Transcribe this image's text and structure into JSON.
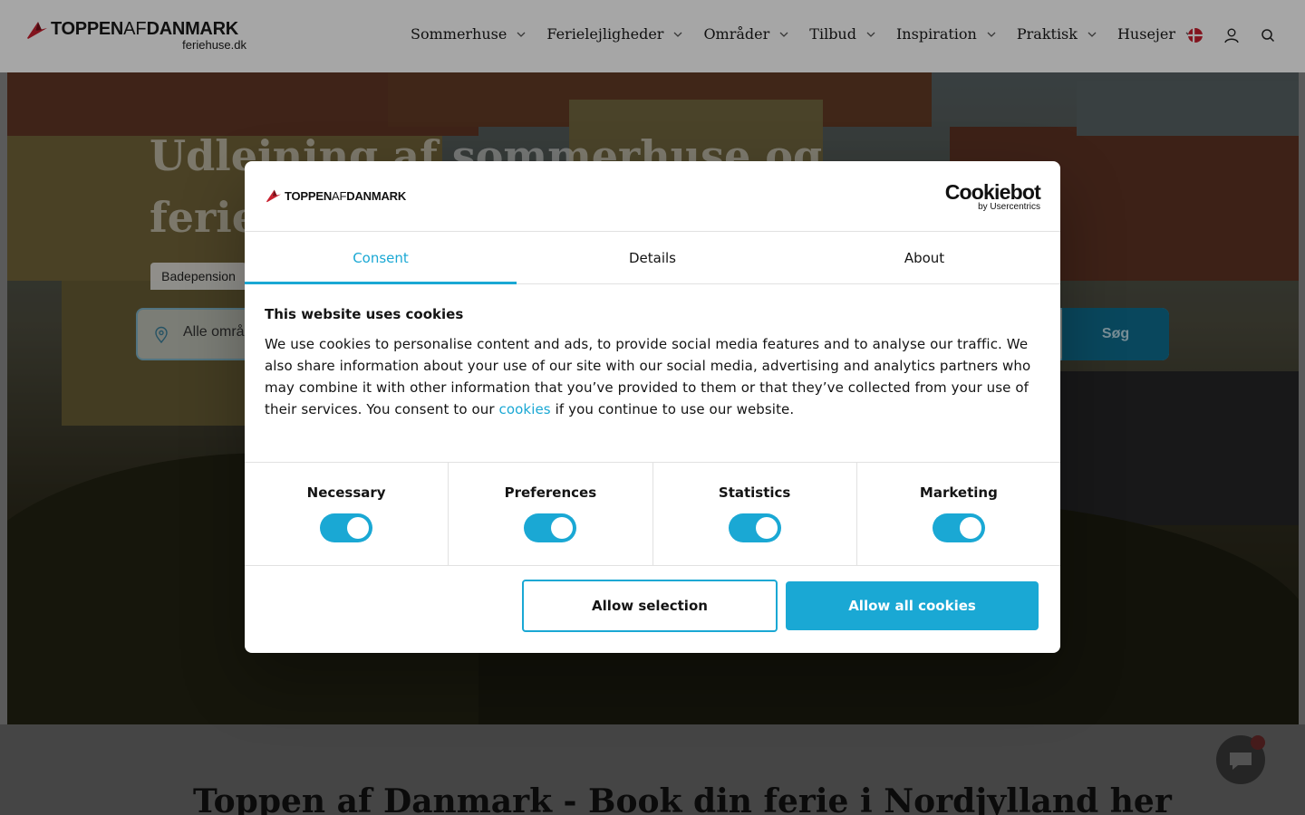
{
  "header": {
    "logo_text_bold_1": "TOPPEN",
    "logo_text_thin": "AF",
    "logo_text_bold_2": "DANMARK",
    "logo_sub": "feriehuse.dk",
    "nav": [
      {
        "label": "Sommerhuse",
        "icon": "chevron-down-icon"
      },
      {
        "label": "Ferielejligheder",
        "icon": "chevron-down-icon"
      },
      {
        "label": "Områder",
        "icon": "chevron-down-icon"
      },
      {
        "label": "Tilbud",
        "icon": "chevron-down-icon"
      },
      {
        "label": "Inspiration",
        "icon": "chevron-down-icon"
      },
      {
        "label": "Praktisk",
        "icon": "chevron-down-icon"
      },
      {
        "label": "Husejer",
        "icon": "chevron-down-icon"
      }
    ],
    "icons": [
      "danish-flag-icon",
      "user-icon",
      "search-icon"
    ]
  },
  "hero": {
    "title": "Udlejning af sommerhuse og ferie",
    "tab_label": "Badepension",
    "search_placeholder": "Alle områ",
    "search_button": "Søg"
  },
  "below": {
    "title": "Toppen af Danmark - Book din ferie i Nordjylland her"
  },
  "cookie_dialog": {
    "logo_bold_1": "TOPPEN",
    "logo_thin": "AF",
    "logo_bold_2": "DANMARK",
    "brand_main": "Cookiebot",
    "brand_sub": "by Usercentrics",
    "tabs": [
      {
        "label": "Consent",
        "active": true
      },
      {
        "label": "Details",
        "active": false
      },
      {
        "label": "About",
        "active": false
      }
    ],
    "title": "This website uses cookies",
    "text_before_link": "We use cookies to personalise content and ads, to provide social media features and to analyse our traffic. We also share information about your use of our site with our social media, advertising and analytics partners who may combine it with other information that you’ve provided to them or that they’ve collected from your use of their services. You consent to our ",
    "link_text": "cookies",
    "text_after_link": " if you continue to use our website.",
    "toggles": [
      {
        "label": "Necessary",
        "on": true
      },
      {
        "label": "Preferences",
        "on": true
      },
      {
        "label": "Statistics",
        "on": true
      },
      {
        "label": "Marketing",
        "on": true
      }
    ],
    "allow_selection": "Allow selection",
    "allow_all": "Allow all cookies"
  },
  "colors": {
    "accent": "#1aa8d4",
    "text": "#141414",
    "logo_red": "#c8202f"
  }
}
